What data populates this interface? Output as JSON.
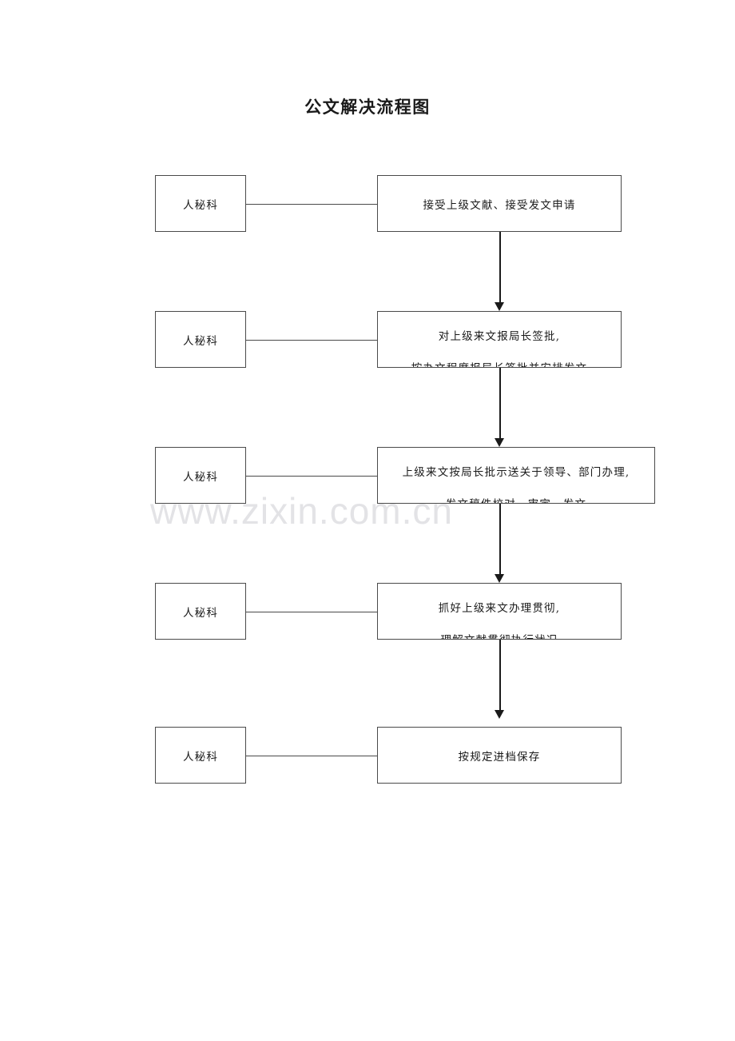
{
  "document": {
    "title": "公文解决流程图",
    "watermark": "www.zixin.com.cn"
  },
  "colors": {
    "box_border": "#4a4a4a",
    "arrow": "#1a1a1a",
    "text": "#1a1a1a",
    "watermark": "#e3e3e6",
    "background": "#ffffff"
  },
  "flow": {
    "steps": [
      {
        "actor": "人秘科",
        "line1": "接受上级文献、接受发文申请",
        "line2": ""
      },
      {
        "actor": "人秘科",
        "line1": "对上级来文报局长签批,",
        "line2": "按办文程度报局长签批并安排发文"
      },
      {
        "actor": "人秘科",
        "line1": "上级来文按局长批示送关于领导、部门办理,",
        "line2": "发文稿件校对、审定、发文"
      },
      {
        "actor": "人秘科",
        "line1": "抓好上级来文办理贯彻,",
        "line2": "理解文献贯彻执行状况"
      },
      {
        "actor": "人秘科",
        "line1": "按规定进档保存",
        "line2": ""
      }
    ]
  }
}
